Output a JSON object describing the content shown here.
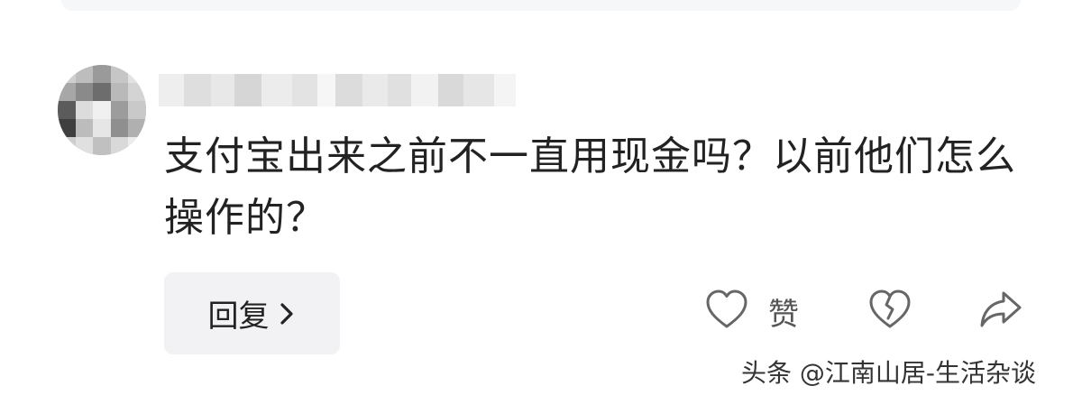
{
  "comment": {
    "text": "支付宝出来之前不一直用现金吗？以前他们怎么操作的？"
  },
  "actions": {
    "reply_label": "回复",
    "like_label": "赞"
  },
  "icons": {
    "reply": "chevron-right-icon",
    "like": "heart-outline-icon",
    "dislike": "broken-heart-icon",
    "share": "share-arrow-icon"
  },
  "watermark": {
    "text": "头条 @江南山居-生活杂谈"
  },
  "colors": {
    "text": "#222222",
    "icon": "#666666",
    "button_bg": "#f2f2f4"
  }
}
